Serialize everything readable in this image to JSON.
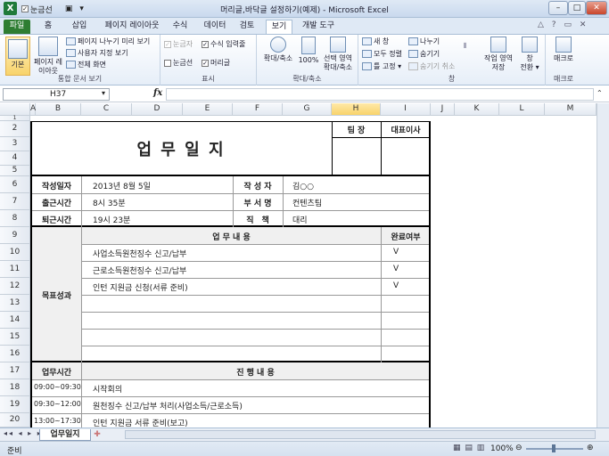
{
  "window": {
    "title": "머리글,바닥글 설정하기(예제) - Microsoft Excel",
    "qat_label": "눈금선",
    "minimize": "–",
    "maximize": "□",
    "close": "✕"
  },
  "tabs": [
    {
      "label": "파일"
    },
    {
      "label": "홈"
    },
    {
      "label": "삽입"
    },
    {
      "label": "페이지 레이아웃"
    },
    {
      "label": "수식"
    },
    {
      "label": "데이터"
    },
    {
      "label": "검토"
    },
    {
      "label": "보기"
    },
    {
      "label": "개발 도구"
    }
  ],
  "ribbon": {
    "views": {
      "normal": "기본",
      "page_layout": "페이지 레이아웃",
      "page_break": "페이지 나누기 미리 보기",
      "custom_views": "사용자 지정 보기",
      "full_screen": "전체 화면",
      "group": "통합 문서 보기"
    },
    "show": {
      "ruler": "눈금자",
      "formula_bar": "수식 입력줄",
      "gridlines": "눈금선",
      "headings": "머리글",
      "group": "표시"
    },
    "zoom": {
      "zoom": "확대/축소",
      "hundred": "100%",
      "selection_line1": "선택 영역",
      "selection_line2": "확대/축소",
      "group": "확대/축소"
    },
    "window": {
      "new_window": "새 창",
      "arrange_all": "모두 정렬",
      "freeze": "틀 고정",
      "split": "나누기",
      "hide": "숨기기",
      "unhide": "숨기기 취소",
      "save_ws_line1": "작업 영역",
      "save_ws_line2": "저장",
      "switch_line1": "창",
      "switch_line2": "전환",
      "group": "창"
    },
    "macro": {
      "label": "매크로",
      "group": "매크로"
    }
  },
  "formula_bar": {
    "name_box": "H37",
    "fx": "fx",
    "value": ""
  },
  "columns": [
    "A",
    "B",
    "C",
    "D",
    "E",
    "F",
    "G",
    "H",
    "I",
    "J",
    "K",
    "L",
    "M"
  ],
  "rows": [
    "1",
    "2",
    "3",
    "4",
    "5",
    "6",
    "7",
    "8",
    "9",
    "10",
    "11",
    "12",
    "13",
    "14",
    "15",
    "16",
    "17",
    "18",
    "19",
    "20"
  ],
  "sheet": {
    "title": "업 무 일 지",
    "approval": {
      "team_leader": "팀 장",
      "ceo": "대표이사"
    },
    "info": [
      {
        "label": "작성일자",
        "value": "2013년 8월 5일",
        "label2": "작 성 자",
        "value2": "김○○"
      },
      {
        "label": "출근시간",
        "value": "8시 35분",
        "label2": "부 서 명",
        "value2": "컨텐츠팀"
      },
      {
        "label": "퇴근시간",
        "value": "19시 23분",
        "label2": "직　책",
        "value2": "대리"
      }
    ],
    "goals_header": "업 무 내 용",
    "done_header": "완료여부",
    "goals_label": "목표성과",
    "goals": [
      {
        "task": "사업소득원천징수 신고/납부",
        "done": "V"
      },
      {
        "task": "근로소득원천징수 신고/납부",
        "done": "V"
      },
      {
        "task": "인턴 지원금 신청(서류 준비)",
        "done": "V"
      }
    ],
    "progress_time_header": "업무시간",
    "progress_header": "진 행 내 용",
    "schedule": [
      {
        "time": "09:00~09:30",
        "task": "시작회의"
      },
      {
        "time": "09:30~12:00",
        "task": "원천징수 신고/납부 처리(사업소득/근로소득)"
      },
      {
        "time": "13:00~17:30",
        "task": "인턴 지원금 서류 준비(보고)"
      }
    ]
  },
  "status": {
    "ready": "준비",
    "sheet_tab": "업무일지",
    "zoom": "100%"
  }
}
